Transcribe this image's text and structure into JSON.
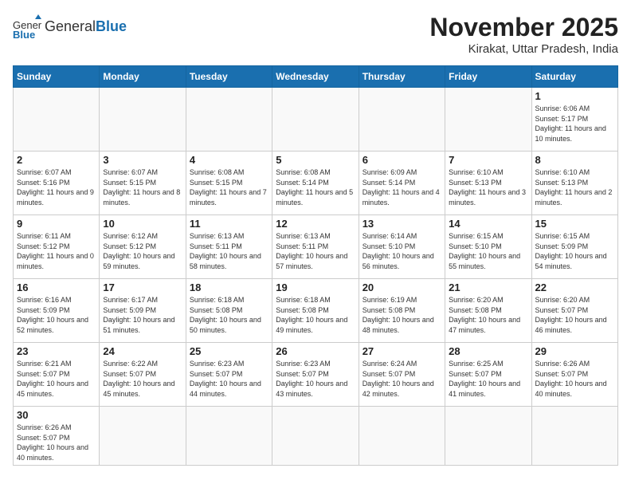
{
  "header": {
    "logo_general": "General",
    "logo_blue": "Blue",
    "month_title": "November 2025",
    "location": "Kirakat, Uttar Pradesh, India"
  },
  "weekdays": [
    "Sunday",
    "Monday",
    "Tuesday",
    "Wednesday",
    "Thursday",
    "Friday",
    "Saturday"
  ],
  "days": {
    "1": {
      "sunrise": "6:06 AM",
      "sunset": "5:17 PM",
      "daylight": "11 hours and 10 minutes."
    },
    "2": {
      "sunrise": "6:07 AM",
      "sunset": "5:16 PM",
      "daylight": "11 hours and 9 minutes."
    },
    "3": {
      "sunrise": "6:07 AM",
      "sunset": "5:15 PM",
      "daylight": "11 hours and 8 minutes."
    },
    "4": {
      "sunrise": "6:08 AM",
      "sunset": "5:15 PM",
      "daylight": "11 hours and 7 minutes."
    },
    "5": {
      "sunrise": "6:08 AM",
      "sunset": "5:14 PM",
      "daylight": "11 hours and 5 minutes."
    },
    "6": {
      "sunrise": "6:09 AM",
      "sunset": "5:14 PM",
      "daylight": "11 hours and 4 minutes."
    },
    "7": {
      "sunrise": "6:10 AM",
      "sunset": "5:13 PM",
      "daylight": "11 hours and 3 minutes."
    },
    "8": {
      "sunrise": "6:10 AM",
      "sunset": "5:13 PM",
      "daylight": "11 hours and 2 minutes."
    },
    "9": {
      "sunrise": "6:11 AM",
      "sunset": "5:12 PM",
      "daylight": "11 hours and 0 minutes."
    },
    "10": {
      "sunrise": "6:12 AM",
      "sunset": "5:12 PM",
      "daylight": "10 hours and 59 minutes."
    },
    "11": {
      "sunrise": "6:13 AM",
      "sunset": "5:11 PM",
      "daylight": "10 hours and 58 minutes."
    },
    "12": {
      "sunrise": "6:13 AM",
      "sunset": "5:11 PM",
      "daylight": "10 hours and 57 minutes."
    },
    "13": {
      "sunrise": "6:14 AM",
      "sunset": "5:10 PM",
      "daylight": "10 hours and 56 minutes."
    },
    "14": {
      "sunrise": "6:15 AM",
      "sunset": "5:10 PM",
      "daylight": "10 hours and 55 minutes."
    },
    "15": {
      "sunrise": "6:15 AM",
      "sunset": "5:09 PM",
      "daylight": "10 hours and 54 minutes."
    },
    "16": {
      "sunrise": "6:16 AM",
      "sunset": "5:09 PM",
      "daylight": "10 hours and 52 minutes."
    },
    "17": {
      "sunrise": "6:17 AM",
      "sunset": "5:09 PM",
      "daylight": "10 hours and 51 minutes."
    },
    "18": {
      "sunrise": "6:18 AM",
      "sunset": "5:08 PM",
      "daylight": "10 hours and 50 minutes."
    },
    "19": {
      "sunrise": "6:18 AM",
      "sunset": "5:08 PM",
      "daylight": "10 hours and 49 minutes."
    },
    "20": {
      "sunrise": "6:19 AM",
      "sunset": "5:08 PM",
      "daylight": "10 hours and 48 minutes."
    },
    "21": {
      "sunrise": "6:20 AM",
      "sunset": "5:08 PM",
      "daylight": "10 hours and 47 minutes."
    },
    "22": {
      "sunrise": "6:20 AM",
      "sunset": "5:07 PM",
      "daylight": "10 hours and 46 minutes."
    },
    "23": {
      "sunrise": "6:21 AM",
      "sunset": "5:07 PM",
      "daylight": "10 hours and 45 minutes."
    },
    "24": {
      "sunrise": "6:22 AM",
      "sunset": "5:07 PM",
      "daylight": "10 hours and 45 minutes."
    },
    "25": {
      "sunrise": "6:23 AM",
      "sunset": "5:07 PM",
      "daylight": "10 hours and 44 minutes."
    },
    "26": {
      "sunrise": "6:23 AM",
      "sunset": "5:07 PM",
      "daylight": "10 hours and 43 minutes."
    },
    "27": {
      "sunrise": "6:24 AM",
      "sunset": "5:07 PM",
      "daylight": "10 hours and 42 minutes."
    },
    "28": {
      "sunrise": "6:25 AM",
      "sunset": "5:07 PM",
      "daylight": "10 hours and 41 minutes."
    },
    "29": {
      "sunrise": "6:26 AM",
      "sunset": "5:07 PM",
      "daylight": "10 hours and 40 minutes."
    },
    "30": {
      "sunrise": "6:26 AM",
      "sunset": "5:07 PM",
      "daylight": "10 hours and 40 minutes."
    }
  }
}
